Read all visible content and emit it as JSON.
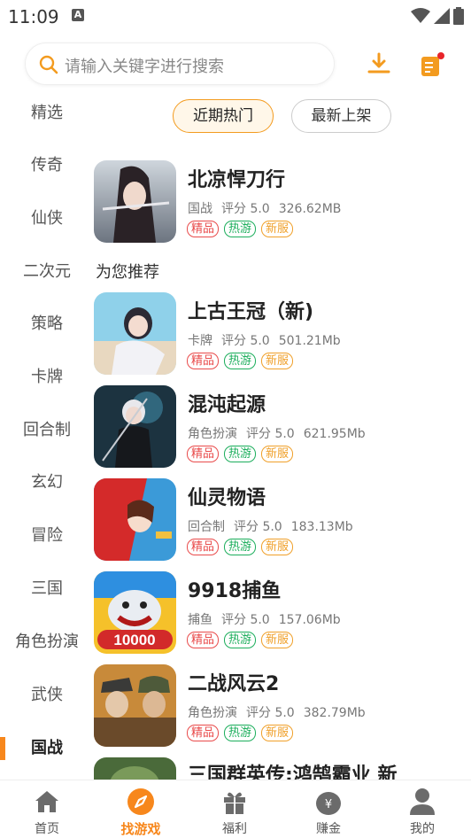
{
  "status": {
    "time": "11:09",
    "notif_letter": "A"
  },
  "search": {
    "placeholder": "请输入关键字进行搜索"
  },
  "categories": [
    "精选",
    "传奇",
    "仙侠",
    "二次元",
    "策略",
    "卡牌",
    "回合制",
    "玄幻",
    "冒险",
    "三国",
    "角色扮演",
    "武侠",
    "国战"
  ],
  "active_category": "国战",
  "tabs": {
    "hot": "近期热门",
    "new": "最新上架"
  },
  "featured": {
    "name": "北凉悍刀行",
    "genre": "国战",
    "rating": "评分 5.0",
    "size": "326.62MB"
  },
  "tags": {
    "jp": "精品",
    "ry": "热游",
    "xf": "新服"
  },
  "section_title": "为您推荐",
  "games": [
    {
      "name": "上古王冠（新)",
      "genre": "卡牌",
      "rating": "评分 5.0",
      "size": "501.21Mb"
    },
    {
      "name": "混沌起源",
      "genre": "角色扮演",
      "rating": "评分 5.0",
      "size": "621.95Mb"
    },
    {
      "name": "仙灵物语",
      "genre": "回合制",
      "rating": "评分 5.0",
      "size": "183.13Mb"
    },
    {
      "name": "9918捕鱼",
      "genre": "捕鱼",
      "rating": "评分 5.0",
      "size": "157.06Mb",
      "thumb_text": "10000"
    },
    {
      "name": "二战风云2",
      "genre": "角色扮演",
      "rating": "评分 5.0",
      "size": "382.79Mb"
    },
    {
      "name": "三国群英传:鸿鹄霸业 新"
    }
  ],
  "nav": [
    {
      "label": "首页",
      "icon": "home-icon"
    },
    {
      "label": "找游戏",
      "icon": "compass-icon"
    },
    {
      "label": "福利",
      "icon": "gift-icon"
    },
    {
      "label": "赚金",
      "icon": "money-bag-icon"
    },
    {
      "label": "我的",
      "icon": "user-icon"
    }
  ],
  "colors": {
    "accent": "#f7871c",
    "tag_jp": "#e94b4b",
    "tag_ry": "#1cae5c",
    "tag_xf": "#f0a02a"
  }
}
